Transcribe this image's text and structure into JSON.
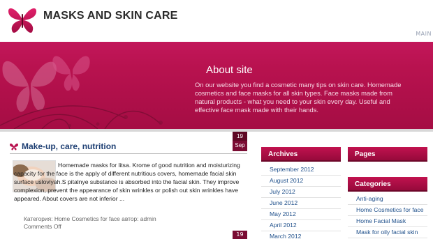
{
  "header": {
    "site_title": "MASKS AND SKIN CARE",
    "main_link": "MAIN"
  },
  "banner": {
    "title": "About site",
    "text": "On our website you find a cosmetic many tips on skin care. Homemade cosmetics and face masks for all skin types. Face masks made from natural products - what you need to your skin every day. Useful and effective face mask made with their hands."
  },
  "post": {
    "title": "Make-up, care, nutrition",
    "date_day": "19",
    "date_month": "Sep",
    "excerpt": "Homemade masks for litsa. Krome of good nutrition and moisturizing capacity for the face is the apply of different nutritious covers, homemade facial skin surface usloviyah.S pitalnye substance is absorbed into the facial skin. They improve complexion, prevent the appearance of skin wrinkles or polish out skin wrinkles have appeared. About covers are not inferior ...",
    "meta_category_label": "Категория:",
    "meta_category": "Home Cosmetics for face",
    "meta_author_label": "автор:",
    "meta_author": "admin",
    "meta_comments": "Comments Off",
    "next_date_day": "19"
  },
  "sidebar": {
    "archives_title": "Archives",
    "archives": [
      "September 2012",
      "August 2012",
      "July 2012",
      "June 2012",
      "May 2012",
      "April 2012",
      "March 2012"
    ],
    "pages_title": "Pages",
    "categories_title": "Categories",
    "categories": [
      "Anti-aging",
      "Home Cosmetics for face",
      "Home Facial Mask",
      "Mask for oily facial skin"
    ]
  },
  "colors": {
    "accent": "#b8124f",
    "link": "#1e4f8a"
  }
}
